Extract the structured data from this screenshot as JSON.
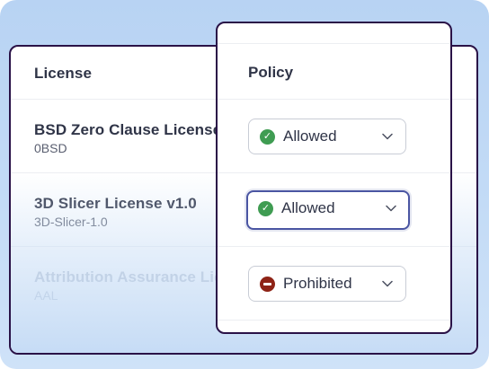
{
  "table": {
    "columns": {
      "license": "License",
      "policy": "Policy"
    },
    "rows": [
      {
        "name": "BSD Zero Clause License",
        "spdx": "0BSD",
        "policy": "Allowed"
      },
      {
        "name": "3D Slicer License v1.0",
        "spdx": "3D-Slicer-1.0",
        "policy": "Allowed"
      },
      {
        "name": "Attribution Assurance License",
        "spdx": "AAL",
        "policy": "Prohibited"
      }
    ]
  },
  "colors": {
    "allowed": "#3f9c52",
    "prohibited": "#8e2316",
    "focus_ring": "#4a55a2",
    "card_border": "#2a1247"
  },
  "icons": {
    "allowed": "check-circle-icon",
    "prohibited": "minus-circle-icon",
    "dropdown": "chevron-down-icon"
  }
}
